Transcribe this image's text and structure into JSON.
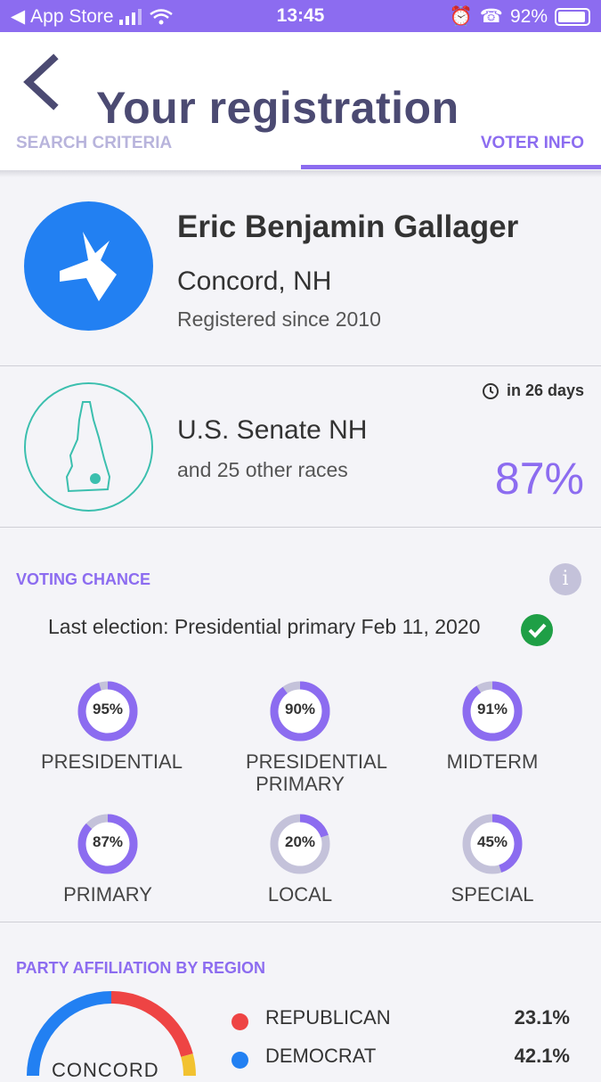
{
  "status_bar": {
    "back_app": "App Store",
    "time": "13:45",
    "battery": "92%"
  },
  "header": {
    "title": "Your registration",
    "tabs": [
      {
        "label": "SEARCH CRITERIA",
        "active": false
      },
      {
        "label": "VOTER INFO",
        "active": true
      }
    ]
  },
  "voter": {
    "name": "Eric Benjamin Gallager",
    "location": "Concord, NH",
    "registered": "Registered since 2010",
    "party_icon": "donkey-icon"
  },
  "race": {
    "countdown": "in 26 days",
    "title": "U.S. Senate NH",
    "others": "and 25 other races",
    "percent": "87%"
  },
  "voting_chance": {
    "label": "VOTING CHANCE",
    "last_election": "Last election: Presidential primary Feb 11, 2020",
    "items": [
      {
        "label": "PRESIDENTIAL",
        "value": "95%",
        "fraction": 0.95
      },
      {
        "label": "PRESIDENTIAL PRIMARY",
        "value": "90%",
        "fraction": 0.9
      },
      {
        "label": "MIDTERM",
        "value": "91%",
        "fraction": 0.91
      },
      {
        "label": "PRIMARY",
        "value": "87%",
        "fraction": 0.87
      },
      {
        "label": "LOCAL",
        "value": "20%",
        "fraction": 0.2
      },
      {
        "label": "SPECIAL",
        "value": "45%",
        "fraction": 0.45
      }
    ]
  },
  "party_affiliation": {
    "label": "PARTY AFFILIATION BY REGION",
    "region": "CONCORD",
    "parties": [
      {
        "name": "REPUBLICAN",
        "value": "23.1%",
        "color": "#ee4444"
      },
      {
        "name": "DEMOCRAT",
        "value": "42.1%",
        "color": "#2280f2"
      }
    ]
  },
  "colors": {
    "accent": "#8c6cf0",
    "democrat": "#2280f2",
    "republican": "#ee4444",
    "track": "#c4c2da"
  }
}
